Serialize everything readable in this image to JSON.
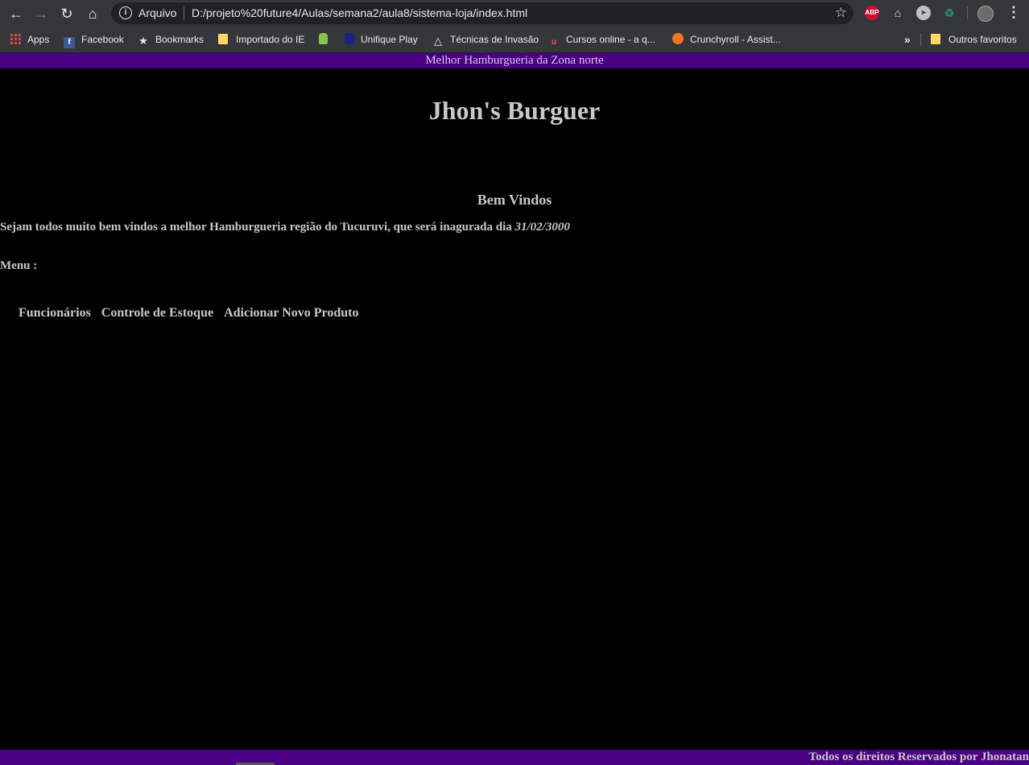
{
  "browser": {
    "omnibox_label": "Arquivo",
    "url": "D:/projeto%20future4/Aulas/semana2/aula8/sistema-loja/index.html",
    "extension_abp_label": "ABP",
    "menu_glyph": "⋮"
  },
  "bookmarks": {
    "items": [
      {
        "label": "Apps",
        "icon": "apps-grid-icon"
      },
      {
        "label": "Facebook",
        "icon": "facebook-icon"
      },
      {
        "label": "Bookmarks",
        "icon": "star-icon"
      },
      {
        "label": "Importado do IE",
        "icon": "folder-icon"
      },
      {
        "label": "",
        "icon": "android-icon"
      },
      {
        "label": "Unifique Play",
        "icon": "unifique-icon"
      },
      {
        "label": "Técnicas de Invasão",
        "icon": "triangle-icon"
      },
      {
        "label": "Cursos online - a q...",
        "icon": "udemy-icon"
      },
      {
        "label": "Crunchyroll - Assist...",
        "icon": "crunchyroll-icon"
      }
    ],
    "overflow": "»",
    "other_folder": "Outros favoritos"
  },
  "page": {
    "top_banner": "Melhor Hamburgueria da Zona norte",
    "site_title": "Jhon's Burguer",
    "section_title": "Bem Vindos",
    "welcome_text": "Sejam todos muito bem vindos a melhor Hamburgueria região do Tucuruvi, que será inagurada dia ",
    "welcome_date": "31/02/3000",
    "menu_label": "Menu :",
    "menu_items": [
      "Funcionários",
      "Controle de Estoque",
      "Adicionar Novo Produto"
    ],
    "footer": "Todos os direitos Reservados por Jhonatan"
  },
  "colors": {
    "banner_bg": "#4b0082",
    "page_bg": "#000000",
    "text": "#c8c8c8"
  }
}
